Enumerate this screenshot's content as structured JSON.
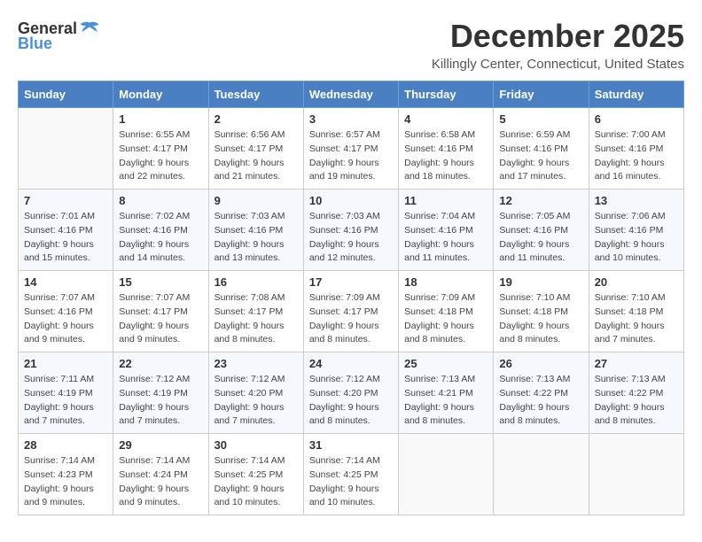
{
  "logo": {
    "text_general": "General",
    "text_blue": "Blue"
  },
  "header": {
    "month": "December 2025",
    "location": "Killingly Center, Connecticut, United States"
  },
  "weekdays": [
    "Sunday",
    "Monday",
    "Tuesday",
    "Wednesday",
    "Thursday",
    "Friday",
    "Saturday"
  ],
  "weeks": [
    [
      {
        "day": "",
        "info": ""
      },
      {
        "day": "1",
        "info": "Sunrise: 6:55 AM\nSunset: 4:17 PM\nDaylight: 9 hours\nand 22 minutes."
      },
      {
        "day": "2",
        "info": "Sunrise: 6:56 AM\nSunset: 4:17 PM\nDaylight: 9 hours\nand 21 minutes."
      },
      {
        "day": "3",
        "info": "Sunrise: 6:57 AM\nSunset: 4:17 PM\nDaylight: 9 hours\nand 19 minutes."
      },
      {
        "day": "4",
        "info": "Sunrise: 6:58 AM\nSunset: 4:16 PM\nDaylight: 9 hours\nand 18 minutes."
      },
      {
        "day": "5",
        "info": "Sunrise: 6:59 AM\nSunset: 4:16 PM\nDaylight: 9 hours\nand 17 minutes."
      },
      {
        "day": "6",
        "info": "Sunrise: 7:00 AM\nSunset: 4:16 PM\nDaylight: 9 hours\nand 16 minutes."
      }
    ],
    [
      {
        "day": "7",
        "info": "Sunrise: 7:01 AM\nSunset: 4:16 PM\nDaylight: 9 hours\nand 15 minutes."
      },
      {
        "day": "8",
        "info": "Sunrise: 7:02 AM\nSunset: 4:16 PM\nDaylight: 9 hours\nand 14 minutes."
      },
      {
        "day": "9",
        "info": "Sunrise: 7:03 AM\nSunset: 4:16 PM\nDaylight: 9 hours\nand 13 minutes."
      },
      {
        "day": "10",
        "info": "Sunrise: 7:03 AM\nSunset: 4:16 PM\nDaylight: 9 hours\nand 12 minutes."
      },
      {
        "day": "11",
        "info": "Sunrise: 7:04 AM\nSunset: 4:16 PM\nDaylight: 9 hours\nand 11 minutes."
      },
      {
        "day": "12",
        "info": "Sunrise: 7:05 AM\nSunset: 4:16 PM\nDaylight: 9 hours\nand 11 minutes."
      },
      {
        "day": "13",
        "info": "Sunrise: 7:06 AM\nSunset: 4:16 PM\nDaylight: 9 hours\nand 10 minutes."
      }
    ],
    [
      {
        "day": "14",
        "info": "Sunrise: 7:07 AM\nSunset: 4:16 PM\nDaylight: 9 hours\nand 9 minutes."
      },
      {
        "day": "15",
        "info": "Sunrise: 7:07 AM\nSunset: 4:17 PM\nDaylight: 9 hours\nand 9 minutes."
      },
      {
        "day": "16",
        "info": "Sunrise: 7:08 AM\nSunset: 4:17 PM\nDaylight: 9 hours\nand 8 minutes."
      },
      {
        "day": "17",
        "info": "Sunrise: 7:09 AM\nSunset: 4:17 PM\nDaylight: 9 hours\nand 8 minutes."
      },
      {
        "day": "18",
        "info": "Sunrise: 7:09 AM\nSunset: 4:18 PM\nDaylight: 9 hours\nand 8 minutes."
      },
      {
        "day": "19",
        "info": "Sunrise: 7:10 AM\nSunset: 4:18 PM\nDaylight: 9 hours\nand 8 minutes."
      },
      {
        "day": "20",
        "info": "Sunrise: 7:10 AM\nSunset: 4:18 PM\nDaylight: 9 hours\nand 7 minutes."
      }
    ],
    [
      {
        "day": "21",
        "info": "Sunrise: 7:11 AM\nSunset: 4:19 PM\nDaylight: 9 hours\nand 7 minutes."
      },
      {
        "day": "22",
        "info": "Sunrise: 7:12 AM\nSunset: 4:19 PM\nDaylight: 9 hours\nand 7 minutes."
      },
      {
        "day": "23",
        "info": "Sunrise: 7:12 AM\nSunset: 4:20 PM\nDaylight: 9 hours\nand 7 minutes."
      },
      {
        "day": "24",
        "info": "Sunrise: 7:12 AM\nSunset: 4:20 PM\nDaylight: 9 hours\nand 8 minutes."
      },
      {
        "day": "25",
        "info": "Sunrise: 7:13 AM\nSunset: 4:21 PM\nDaylight: 9 hours\nand 8 minutes."
      },
      {
        "day": "26",
        "info": "Sunrise: 7:13 AM\nSunset: 4:22 PM\nDaylight: 9 hours\nand 8 minutes."
      },
      {
        "day": "27",
        "info": "Sunrise: 7:13 AM\nSunset: 4:22 PM\nDaylight: 9 hours\nand 8 minutes."
      }
    ],
    [
      {
        "day": "28",
        "info": "Sunrise: 7:14 AM\nSunset: 4:23 PM\nDaylight: 9 hours\nand 9 minutes."
      },
      {
        "day": "29",
        "info": "Sunrise: 7:14 AM\nSunset: 4:24 PM\nDaylight: 9 hours\nand 9 minutes."
      },
      {
        "day": "30",
        "info": "Sunrise: 7:14 AM\nSunset: 4:25 PM\nDaylight: 9 hours\nand 10 minutes."
      },
      {
        "day": "31",
        "info": "Sunrise: 7:14 AM\nSunset: 4:25 PM\nDaylight: 9 hours\nand 10 minutes."
      },
      {
        "day": "",
        "info": ""
      },
      {
        "day": "",
        "info": ""
      },
      {
        "day": "",
        "info": ""
      }
    ]
  ]
}
